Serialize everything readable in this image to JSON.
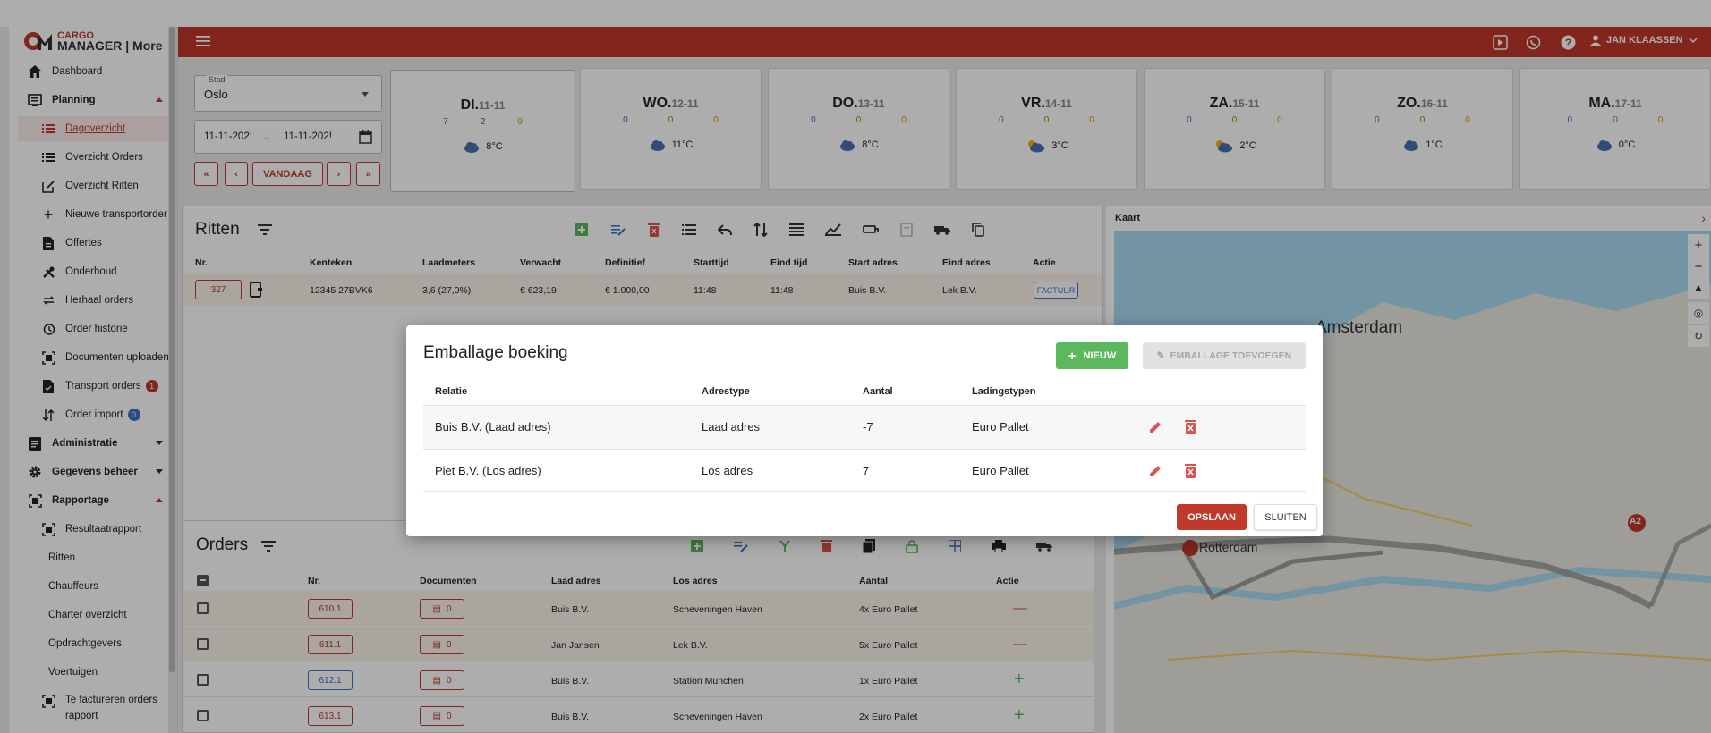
{
  "app": {
    "logo_line1": "CARGO",
    "logo_line2": "MANAGER | More",
    "user_name": "JAN KLAASSEN"
  },
  "sidebar": {
    "items": [
      {
        "label": "Dashboard"
      },
      {
        "label": "Planning"
      },
      {
        "label": "Dagoverzicht"
      },
      {
        "label": "Overzicht Orders"
      },
      {
        "label": "Overzicht Ritten"
      },
      {
        "label": "Nieuwe transportorder"
      },
      {
        "label": "Offertes"
      },
      {
        "label": "Onderhoud"
      },
      {
        "label": "Herhaal orders"
      },
      {
        "label": "Order historie"
      },
      {
        "label": "Documenten uploaden"
      },
      {
        "label": "Transport orders",
        "badge": "1"
      },
      {
        "label": "Order import",
        "badge": "0"
      },
      {
        "label": "Administratie"
      },
      {
        "label": "Gegevens beheer"
      },
      {
        "label": "Rapportage"
      },
      {
        "label": "Resultaatrapport"
      },
      {
        "label": "Ritten"
      },
      {
        "label": "Chauffeurs"
      },
      {
        "label": "Charter overzicht"
      },
      {
        "label": "Opdrachtgevers"
      },
      {
        "label": "Voertuigen"
      },
      {
        "label": "Te factureren orders rapport"
      }
    ]
  },
  "filters": {
    "city_label": "Stad",
    "city_value": "Oslo",
    "date_from": "11-11-202!",
    "date_to": "11-11-202!",
    "today_label": "VANDAAG"
  },
  "days": [
    {
      "name": "DI.",
      "date": "11-11",
      "c1": "7",
      "c2": "2",
      "c3": "9",
      "temp": "8°C"
    },
    {
      "name": "WO.",
      "date": "12-11",
      "c1": "0",
      "c2": "0",
      "c3": "0",
      "temp": "11°C"
    },
    {
      "name": "DO.",
      "date": "13-11",
      "c1": "0",
      "c2": "0",
      "c3": "0",
      "temp": "8°C"
    },
    {
      "name": "VR.",
      "date": "14-11",
      "c1": "0",
      "c2": "0",
      "c3": "0",
      "temp": "3°C"
    },
    {
      "name": "ZA.",
      "date": "15-11",
      "c1": "0",
      "c2": "0",
      "c3": "0",
      "temp": "2°C"
    },
    {
      "name": "ZO.",
      "date": "16-11",
      "c1": "0",
      "c2": "0",
      "c3": "0",
      "temp": "1°C"
    },
    {
      "name": "MA.",
      "date": "17-11",
      "c1": "0",
      "c2": "0",
      "c3": "0",
      "temp": "0°C"
    }
  ],
  "ritten": {
    "title": "Ritten",
    "columns": [
      "Nr.",
      "Kenteken",
      "Laadmeters",
      "Verwacht",
      "Definitief",
      "Starttijd",
      "Eind tijd",
      "Start adres",
      "Eind adres",
      "Actie"
    ],
    "rows": [
      {
        "nr": "327",
        "kenteken": "12345 27BVK6",
        "laadmeters": "3,6 (27,0%)",
        "verwacht": "€ 623,19",
        "definitief": "€ 1.000,00",
        "starttijd": "11:48",
        "eindtijd": "11:48",
        "start": "Buis B.V.",
        "eind": "Lek B.V.",
        "actie": "FACTUUR"
      }
    ]
  },
  "orders": {
    "title": "Orders",
    "columns": [
      "Nr.",
      "Documenten",
      "Laad adres",
      "Los adres",
      "Aantal",
      "Actie"
    ],
    "rows": [
      {
        "nr": "610.1",
        "docs": "0",
        "laad": "Buis B.V.",
        "los": "Scheveningen Haven",
        "aantal": "4x Euro Pallet",
        "actie": "—"
      },
      {
        "nr": "611.1",
        "docs": "0",
        "laad": "Jan Jansen",
        "los": "Lek B.V.",
        "aantal": "5x Euro Pallet",
        "actie": "—"
      },
      {
        "nr": "612.1",
        "docs": "0",
        "laad": "Buis B.V.",
        "los": "Station Munchen",
        "aantal": "1x Euro Pallet",
        "actie": "+"
      },
      {
        "nr": "613.1",
        "docs": "0",
        "laad": "Buis B.V.",
        "los": "Scheveningen Haven",
        "aantal": "2x Euro Pallet",
        "actie": "+"
      }
    ]
  },
  "map": {
    "title": "Kaart",
    "labels": [
      "Amsterdam",
      "Rotterdam",
      "A2"
    ]
  },
  "modal": {
    "title": "Emballage boeking",
    "new_label": "NIEUW",
    "add_label": "EMBALLAGE TOEVOEGEN",
    "columns": [
      "Relatie",
      "Adrestype",
      "Aantal",
      "Ladingstypen"
    ],
    "rows": [
      {
        "relatie": "Buis B.V. (Laad adres)",
        "adrestype": "Laad adres",
        "aantal": "-7",
        "ladingstype": "Euro Pallet"
      },
      {
        "relatie": "Piet B.V. (Los adres)",
        "adrestype": "Los adres",
        "aantal": "7",
        "ladingstype": "Euro Pallet"
      }
    ],
    "save_label": "OPSLAAN",
    "close_label": "SLUITEN"
  },
  "colors": {
    "brand": "#c0392b",
    "green": "#5cb85c",
    "blue": "#3d6fc6"
  }
}
